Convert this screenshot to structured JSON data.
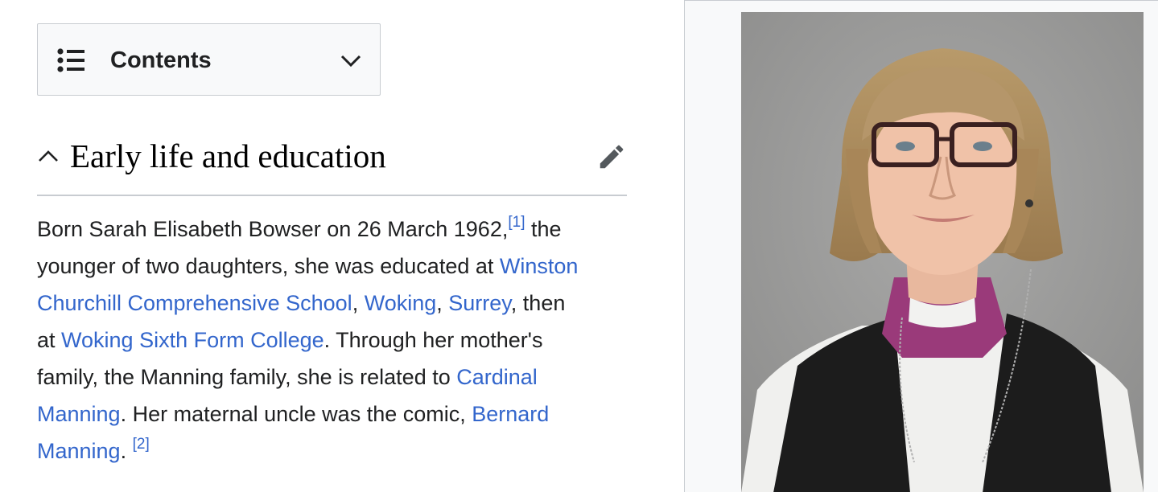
{
  "toc": {
    "label": "Contents",
    "icon": "list-bullet-icon",
    "toggle_icon": "chevron-down-icon"
  },
  "section": {
    "title": "Early life and education",
    "collapse_icon": "chevron-up-icon",
    "edit_icon": "pencil-icon"
  },
  "paragraph": {
    "t1": "Born Sarah Elisabeth Bowser on 26 March 1962,",
    "ref1": "[1]",
    "t2": " the",
    "t3": "younger of two daughters, she was educated at ",
    "link_school_a": "Winston",
    "link_school_b": "Churchill Comprehensive School",
    "t4": ", ",
    "link_woking": "Woking",
    "t5": ", ",
    "link_surrey": "Surrey",
    "t6": ", then",
    "t7": "at ",
    "link_college": "Woking Sixth Form College",
    "t8": ". Through her mother's",
    "t9": "family, the Manning family, she is related to ",
    "link_cardinal_a": "Cardinal",
    "link_cardinal_b": "Manning",
    "t10": ". Her maternal uncle was the comic, ",
    "link_bernard_a": "Bernard",
    "link_bernard_b": "Manning",
    "t11": ". ",
    "ref2": "[2]"
  },
  "colors": {
    "link": "#3366cc",
    "text": "#202122",
    "border": "#c8ccd1",
    "infobox_bg": "#f8f9fa"
  }
}
